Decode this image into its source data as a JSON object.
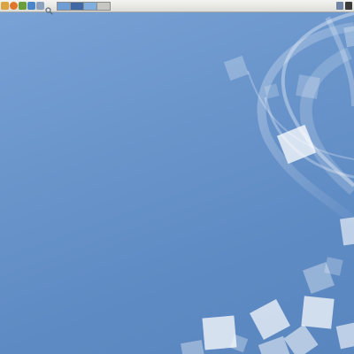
{
  "desktop": {
    "wallpaper": "blue-gradient-with-swooshes",
    "colors": {
      "bg_top": "#7aa3d6",
      "bg_bottom": "#5a86bf"
    }
  },
  "top_panel": {
    "launchers": [
      {
        "icon": "gnome-foot-icon",
        "color": "#d9a441"
      },
      {
        "icon": "firefox-icon",
        "color": "#e2752a"
      },
      {
        "icon": "mail-icon",
        "color": "#6a9e3a"
      },
      {
        "icon": "text-editor-icon",
        "color": "#4a86c9"
      },
      {
        "icon": "file-manager-icon",
        "color": "#8aa0bc"
      },
      {
        "icon": "search-icon",
        "color": "#7d8ea3"
      }
    ],
    "workspaces": [
      {
        "name": "workspace-1",
        "color": "#6d9fd6"
      },
      {
        "name": "workspace-2",
        "color": "#3f68a5"
      },
      {
        "name": "workspace-3",
        "color": "#7faedf"
      },
      {
        "name": "workspace-4",
        "color": "#c7c7c2"
      }
    ],
    "tray": [
      {
        "icon": "network-icon",
        "color": "#6f86a6"
      },
      {
        "icon": "volume-icon",
        "color": "#3b3b3b"
      }
    ]
  }
}
